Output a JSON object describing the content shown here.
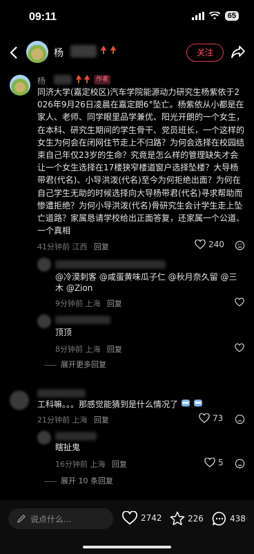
{
  "status_bar": {
    "time": "09:11",
    "battery": "65"
  },
  "header": {
    "username": "杨",
    "follow_label": "关注"
  },
  "main_comment": {
    "name": "杨",
    "author_tag": "作者",
    "text": "同济大学(嘉定校区)汽车学院能源动力研究生杨紫依于2026年9月26日凌晨在嘉定朗6°坠亡。杨紫依从小都是在家人、老师、同学眼里品学兼优、阳光开朗的一个女生，在本科、研究生期间的学生骨干、党员班长，一个这样的女生为何会在闭网住节走上不归路？为何会选择在校园结束自己年仅23岁的生命？究竟是怎么样的管理缺失才会让一个女生选择在17楼狭窄楼道窗户选择坠楼？大导杨带君(代名)、小导洪泼(代名)至今为何拒绝出面？为何在自己学生无助的时候选择向大导杨带君(代名)寻求帮助而惨遭拒绝？为何小导洪泼(代名)骨研究生会计学生走上坠亡道路？家属恳请学校给出正面答复，还家属一个公道、一个真相",
    "time": "41分钟前",
    "location": "江西",
    "reply": "回复",
    "likes": "240"
  },
  "replies": [
    {
      "text": "@冷漠刺客 @咸蛋黄味瓜子仁 @秋月奈久留 @三木 @Zion",
      "time": "9分钟前",
      "location": "上海",
      "reply": "回复"
    },
    {
      "text": "顶顶",
      "time": "8分钟前",
      "location": "上海",
      "reply": "回复"
    }
  ],
  "expand_1": "展开更多回复",
  "comment_2": {
    "text": "工科嘛。。。那感觉能猜到是什么情况了",
    "time": "21分钟前",
    "location": "上海",
    "reply": "回复",
    "likes": "73"
  },
  "reply_3": {
    "text": "瞎扯鬼",
    "time": "16分钟前",
    "location": "上海",
    "reply": "回复",
    "likes": "5"
  },
  "expand_2": "展开 10 条回复",
  "bottom": {
    "placeholder": "说点什么...",
    "likes": "2742",
    "stars": "226",
    "comments": "438"
  }
}
